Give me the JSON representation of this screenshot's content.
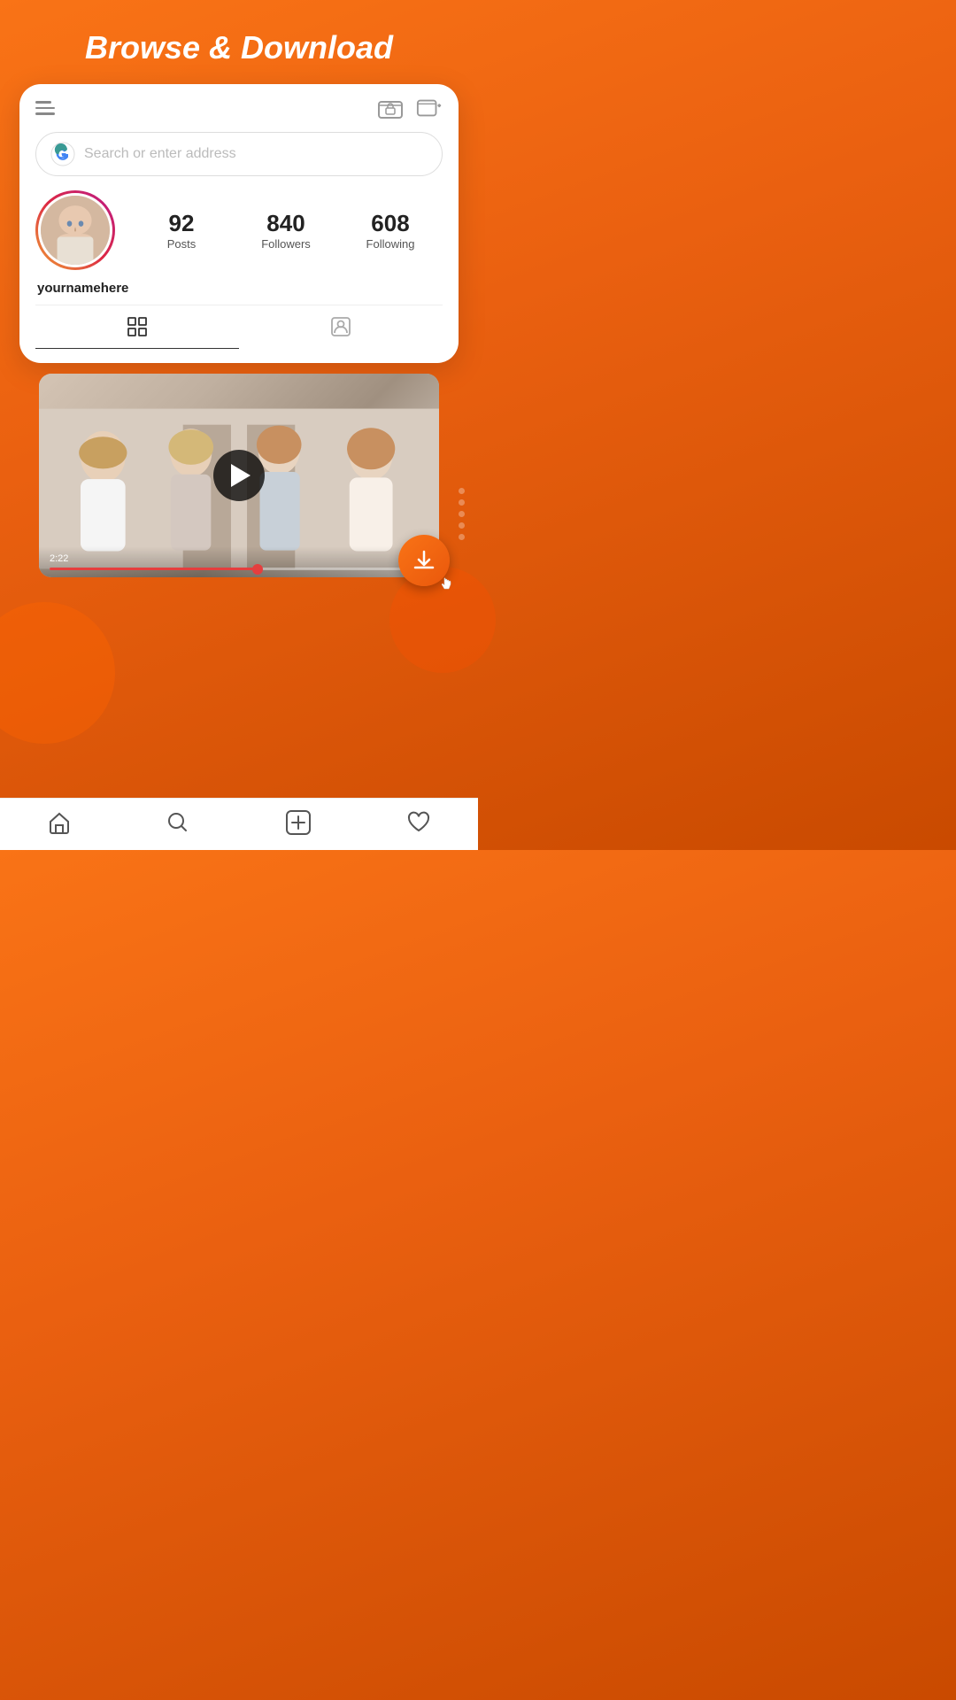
{
  "hero": {
    "title": "Browse & Download"
  },
  "browser": {
    "search_placeholder": "Search or enter address"
  },
  "profile": {
    "username": "yournamehere",
    "posts_count": "92",
    "posts_label": "Posts",
    "followers_count": "840",
    "followers_label": "Followers",
    "following_count": "608",
    "following_label": "Following"
  },
  "video": {
    "timestamp": "2:22"
  },
  "nav": {
    "home": "Home",
    "search": "Search",
    "add": "Add",
    "favorites": "Favorites"
  }
}
